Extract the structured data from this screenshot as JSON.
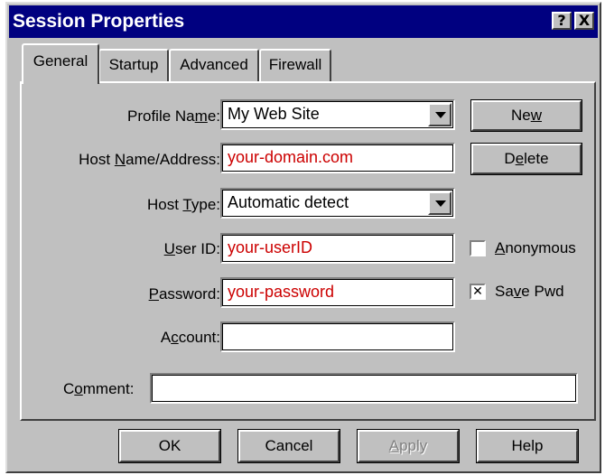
{
  "window": {
    "title": "Session Properties"
  },
  "title_buttons": {
    "help": "?",
    "close": "X"
  },
  "tabs": [
    {
      "label": "General",
      "active": true
    },
    {
      "label": "Startup",
      "active": false
    },
    {
      "label": "Advanced",
      "active": false
    },
    {
      "label": "Firewall",
      "active": false
    }
  ],
  "form": {
    "profile_name": {
      "label_pre": "Profile Na",
      "label_key": "m",
      "label_post": "e:",
      "value": "My Web Site"
    },
    "host_name": {
      "label_pre": "Host ",
      "label_key": "N",
      "label_post": "ame/Address:",
      "value": "your-domain.com"
    },
    "host_type": {
      "label_pre": "Host ",
      "label_key": "T",
      "label_post": "ype:",
      "value": "Automatic detect"
    },
    "user_id": {
      "label_pre": "",
      "label_key": "U",
      "label_post": "ser ID:",
      "value": "your-userID"
    },
    "password": {
      "label_pre": "",
      "label_key": "P",
      "label_post": "assword:",
      "value": "your-password"
    },
    "account": {
      "label_pre": "A",
      "label_key": "c",
      "label_post": "count:",
      "value": ""
    },
    "comment": {
      "label_pre": "C",
      "label_key": "o",
      "label_post": "mment:",
      "value": ""
    }
  },
  "side_buttons": {
    "new": {
      "pre": "Ne",
      "key": "w",
      "post": ""
    },
    "delete": {
      "pre": "D",
      "key": "e",
      "post": "lete"
    }
  },
  "checkboxes": {
    "anonymous": {
      "pre": "",
      "key": "A",
      "post": "nonymous",
      "checked": false,
      "mark": ""
    },
    "save_pwd": {
      "pre": "Sa",
      "key": "v",
      "post": "e Pwd",
      "checked": true,
      "mark": "✕"
    }
  },
  "footer_buttons": {
    "ok": "OK",
    "cancel": "Cancel",
    "apply": {
      "pre": "",
      "key": "A",
      "post": "pply",
      "disabled": true
    },
    "help": "Help"
  },
  "colors": {
    "titlebar": "#000080",
    "face": "#c0c0c0",
    "field_text_red": "#cc0000"
  }
}
